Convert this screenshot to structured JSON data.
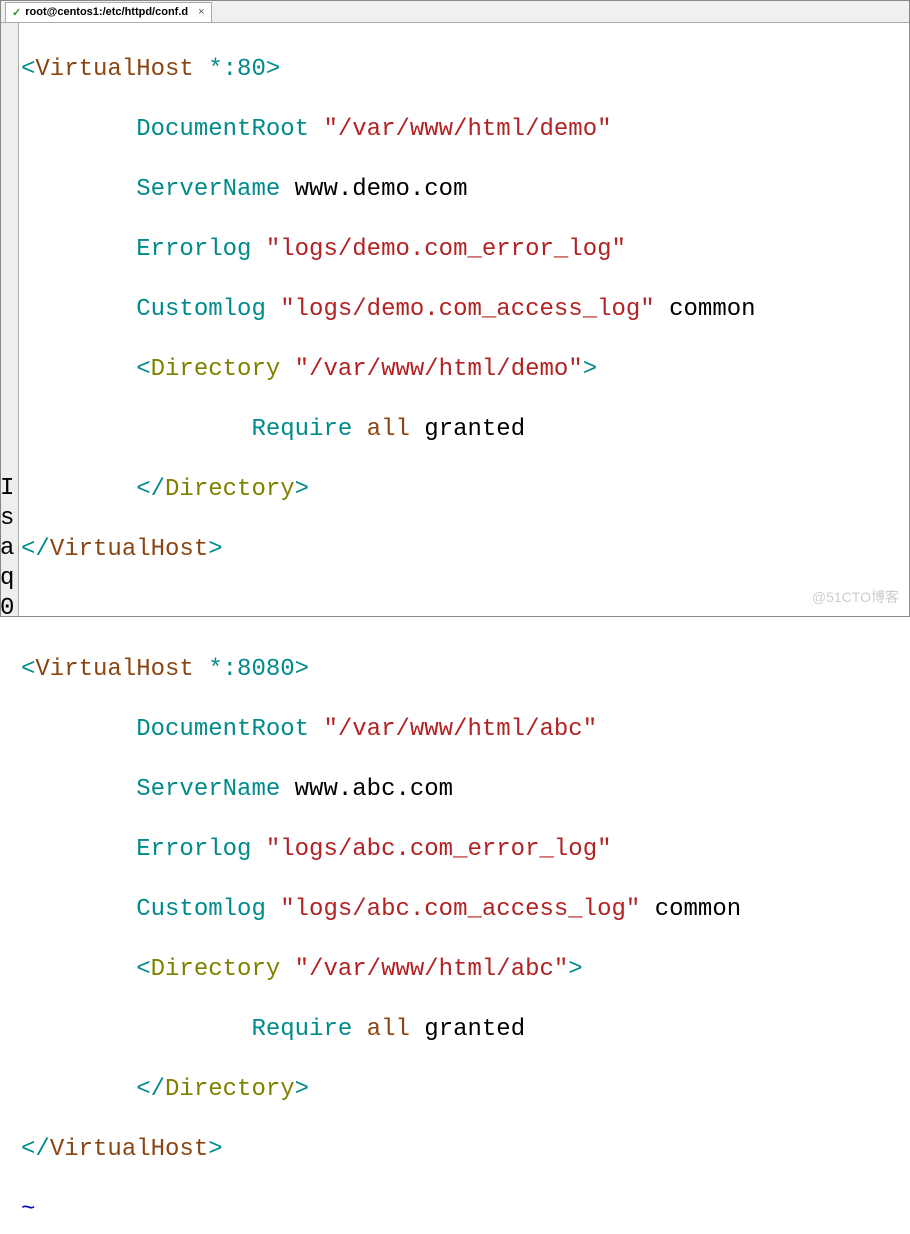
{
  "tab": {
    "title": "root@centos1:/etc/httpd/conf.d",
    "close": "×",
    "check": "✓"
  },
  "vhost1": {
    "open_lt": "<",
    "open_name": "VirtualHost",
    "open_attr": " *:80",
    "open_gt": ">",
    "docroot_key": "DocumentRoot",
    "docroot_val": "\"/var/www/html/demo\"",
    "servername_key": "ServerName",
    "servername_val": "www.demo.com",
    "errorlog_key": "Errorlog",
    "errorlog_val": "\"logs/demo.com_error_log\"",
    "customlog_key": "Customlog",
    "customlog_val": "\"logs/demo.com_access_log\"",
    "customlog_arg": "common",
    "dir_open_lt": "<",
    "dir_open_name": "Directory",
    "dir_open_attr": " \"/var/www/html/demo\"",
    "dir_open_gt": ">",
    "require_key": "Require",
    "require_v1": "all",
    "require_v2": "granted",
    "dir_close_lt": "<",
    "dir_close_slash": "/",
    "dir_close_name": "Directory",
    "dir_close_gt": ">",
    "close_lt": "<",
    "close_slash": "/",
    "close_name": "VirtualHost",
    "close_gt": ">"
  },
  "vhost2": {
    "open_lt": "<",
    "open_name": "VirtualHost",
    "open_attr": " *:8080",
    "open_gt": ">",
    "docroot_key": "DocumentRoot",
    "docroot_val": "\"/var/www/html/abc\"",
    "servername_key": "ServerName",
    "servername_val": "www.abc.com",
    "errorlog_key": "Errorlog",
    "errorlog_val": "\"logs/abc.com_error_log\"",
    "customlog_key": "Customlog",
    "customlog_val": "\"logs/abc.com_access_log\"",
    "customlog_arg": "common",
    "dir_open_lt": "<",
    "dir_open_name": "Directory",
    "dir_open_attr": " \"/var/www/html/abc\"",
    "dir_open_gt": ">",
    "require_key": "Require",
    "require_v1": "all",
    "require_v2": "granted",
    "dir_close_lt": "<",
    "dir_close_slash": "/",
    "dir_close_name": "Directory",
    "dir_close_gt": ">",
    "close_lt": "<",
    "close_slash": "/",
    "close_name": "VirtualHost",
    "close_gt": ">"
  },
  "tilde": "~",
  "watermark": "@51CTO博客",
  "left_edge": "\n\n\n\n\n\n\n\n\n\n\n\n\n\n\nI\ns\na\nq\n0"
}
